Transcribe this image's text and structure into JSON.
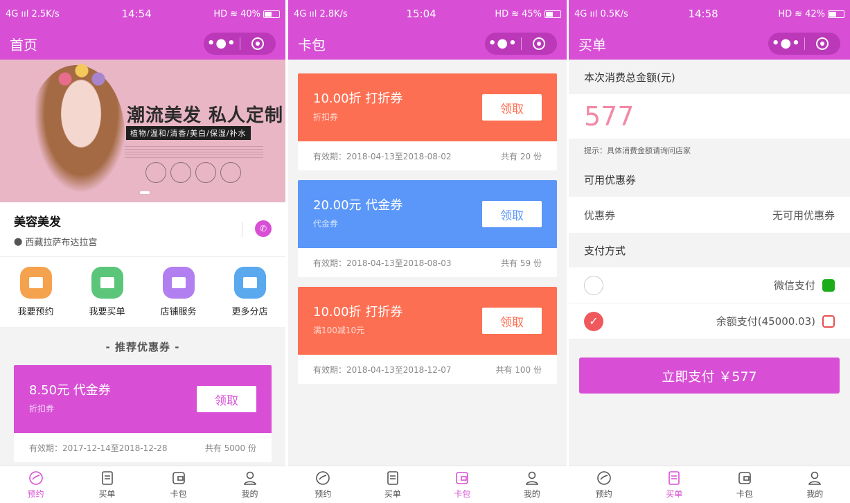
{
  "screens": [
    {
      "status": {
        "signal": "4G",
        "speed": "2.5K/s",
        "time": "14:54",
        "hd": "HD",
        "battery": "40%"
      },
      "title": "首页",
      "capsule": {
        "more": "•●•"
      },
      "store": {
        "name": "美容美发",
        "address": "西藏拉萨布达拉宫"
      },
      "banner": {
        "headline": "潮流美发 私人定制",
        "subline": "植物/温和/清香/美白/保湿/补水"
      },
      "quick": [
        {
          "label": "我要预约",
          "color": "#f5a24e"
        },
        {
          "label": "我要买单",
          "color": "#5bc67a"
        },
        {
          "label": "店铺服务",
          "color": "#b27ff0"
        },
        {
          "label": "更多分店",
          "color": "#5aa8ee"
        }
      ],
      "recommend_title": "- 推荐优惠券 -",
      "coupon": {
        "main": "8.50元 代金券",
        "sub": "折扣券",
        "btn": "领取",
        "validity": "有效期：2017-12-14至2018-12-28",
        "count": "共有 5000 份"
      }
    },
    {
      "status": {
        "signal": "4G",
        "speed": "2.8K/s",
        "time": "15:04",
        "hd": "HD",
        "battery": "45%"
      },
      "title": "卡包",
      "capsule": {
        "more": "•●•"
      },
      "coupons": [
        {
          "main": "10.00折 打折券",
          "sub": "折扣券",
          "btn": "领取",
          "validity": "有效期：2018-04-13至2018-08-02",
          "count": "共有 20 份",
          "color": "#fd6f52"
        },
        {
          "main": "20.00元 代金券",
          "sub": "代金券",
          "btn": "领取",
          "validity": "有效期：2018-04-13至2018-08-03",
          "count": "共有 59 份",
          "color": "#5b97f9"
        },
        {
          "main": "10.00折 打折券",
          "sub": "满100减10元",
          "btn": "领取",
          "validity": "有效期：2018-04-13至2018-12-07",
          "count": "共有 100 份",
          "color": "#fd6f52"
        }
      ]
    },
    {
      "status": {
        "signal": "4G",
        "speed": "0.5K/s",
        "time": "14:58",
        "hd": "HD",
        "battery": "42%"
      },
      "title": "买单",
      "capsule": {
        "more": "•●•"
      },
      "total_label": "本次消费总金额(元)",
      "total_value": "577",
      "tip": "提示：具体消费金额请询问店家",
      "coupon_section": "可用优惠券",
      "coupon_label": "优惠券",
      "coupon_value": "无可用优惠券",
      "payment_section": "支付方式",
      "payments": [
        {
          "label": "微信支付",
          "icon": "wechat-icon",
          "color": "#1aad19",
          "selected": false
        },
        {
          "label": "余额支付(45000.03)",
          "icon": "wallet-icon",
          "color": "#e8504f",
          "selected": true
        }
      ],
      "pay_button": "立即支付 ￥577"
    }
  ],
  "tabs": [
    "预约",
    "买单",
    "卡包",
    "我的"
  ],
  "active_color": "#d84fd6"
}
